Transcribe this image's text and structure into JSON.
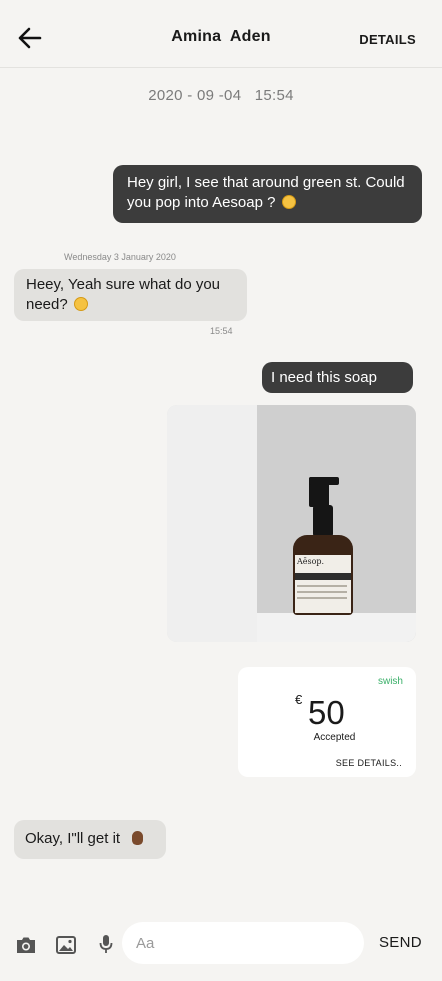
{
  "header": {
    "title": "Amina  Aden",
    "details_label": "DETAILS"
  },
  "conversation": {
    "datestamp": "2020 - 09 -04   15:54",
    "messages": [
      {
        "from": "me",
        "text": "Hey girl, I see that around green st. Could you pop into Aesoap ? ",
        "emoji": "grinning-emoji"
      },
      {
        "from": "them",
        "day_label": "Wednesday 3 January 2020",
        "text": "Heey, Yeah sure what do you need? ",
        "emoji": "smiling-emoji",
        "time": "15:54"
      },
      {
        "from": "me",
        "text": "I need this soap"
      },
      {
        "from": "me",
        "type": "image",
        "brand_text": "Aēsop."
      },
      {
        "from": "me",
        "type": "payment",
        "provider": "swish",
        "currency": "€",
        "amount": "50",
        "status": "Accepted",
        "details_link": "SEE DETAILS.."
      },
      {
        "from": "them",
        "text": "Okay, I\"ll get it ",
        "emoji": "ok-hand-emoji"
      }
    ]
  },
  "composer": {
    "placeholder": "Aa",
    "send_label": "SEND",
    "icons": [
      "camera-icon",
      "gallery-icon",
      "microphone-icon"
    ]
  },
  "colors": {
    "background": "#f5f4f2",
    "outgoing_bubble": "#3c3c3c",
    "incoming_bubble": "#e2e1de",
    "swish_green": "#3bb06a"
  }
}
